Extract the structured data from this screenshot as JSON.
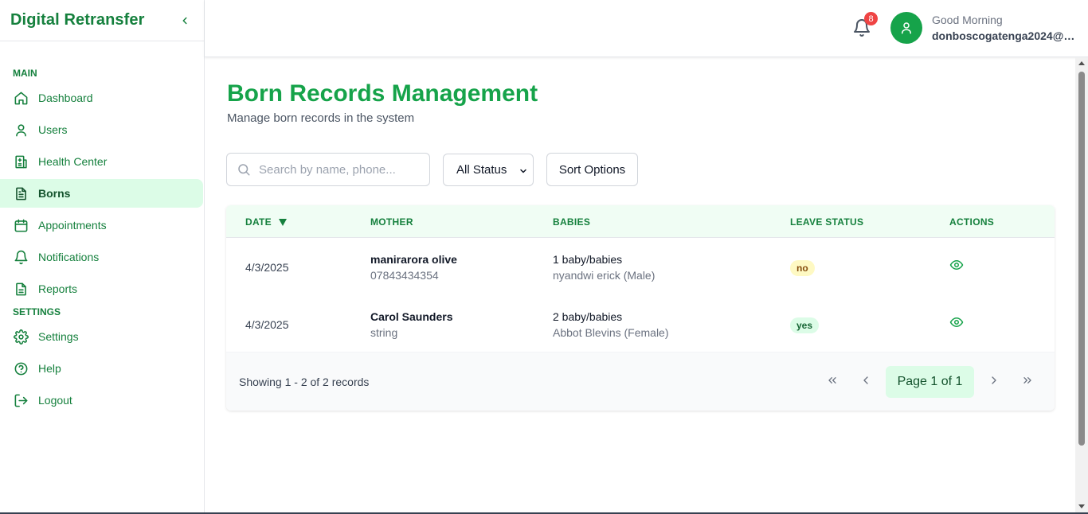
{
  "sidebar": {
    "brand": "Digital Retransfer",
    "sections": {
      "main": "MAIN",
      "settings": "SETTINGS"
    },
    "main_items": [
      {
        "label": "Dashboard",
        "icon": "home-icon"
      },
      {
        "label": "Users",
        "icon": "user-icon"
      },
      {
        "label": "Health Center",
        "icon": "hospital-icon"
      },
      {
        "label": "Borns",
        "icon": "file-text-icon",
        "active": true
      },
      {
        "label": "Appointments",
        "icon": "calendar-icon"
      },
      {
        "label": "Notifications",
        "icon": "bell-icon"
      },
      {
        "label": "Reports",
        "icon": "report-icon"
      }
    ],
    "settings_items": [
      {
        "label": "Settings",
        "icon": "gear-icon"
      },
      {
        "label": "Help",
        "icon": "help-circle-icon"
      },
      {
        "label": "Logout",
        "icon": "logout-icon"
      }
    ]
  },
  "header": {
    "notification_count": "8",
    "greeting": "Good Morning",
    "user_email": "donboscogatenga2024@g..."
  },
  "main": {
    "title": "Born Records Management",
    "subtitle": "Manage born records in the system",
    "search_placeholder": "Search by name, phone...",
    "status_filter": "All Status",
    "sort_label": "Sort Options"
  },
  "table": {
    "headers": {
      "date": "DATE",
      "mother": "MOTHER",
      "babies": "BABIES",
      "leave_status": "LEAVE STATUS",
      "actions": "ACTIONS"
    },
    "rows": [
      {
        "date": "4/3/2025",
        "mother_name": "manirarora olive",
        "mother_phone": "07843434354",
        "babies_count": "1 baby/babies",
        "babies_detail": "nyandwi erick (Male)",
        "leave_status": "no"
      },
      {
        "date": "4/3/2025",
        "mother_name": "Carol Saunders",
        "mother_phone": "string",
        "babies_count": "2 baby/babies",
        "babies_detail": "Abbot Blevins (Female)",
        "leave_status": "yes"
      }
    ],
    "showing": "Showing 1 - 2 of 2 records",
    "page_indicator": "Page 1 of 1"
  },
  "colors": {
    "brand_green": "#16a34a",
    "active_bg": "#dcfce7",
    "header_bg": "#f0fdf4",
    "badge_red": "#ef4444"
  }
}
